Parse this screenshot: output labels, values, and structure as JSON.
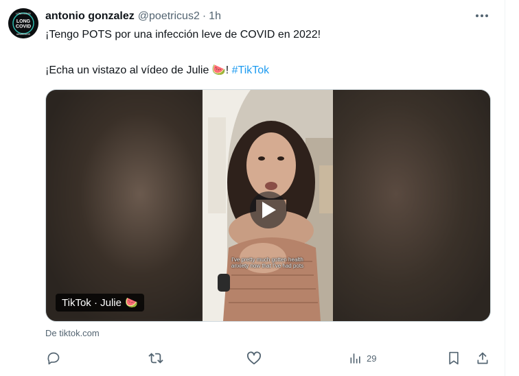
{
  "tweet": {
    "author_name": "antonio gonzalez",
    "handle": "@poetricus2",
    "separator": "·",
    "time": "1h",
    "text_line1": "¡Tengo POTS por una infección leve de COVID en 2022!",
    "text_line2": "¡Echa un vistazo al vídeo de Julie",
    "watermelon": "🍉",
    "text_line2_end": "!",
    "hashtag": "#TikTok"
  },
  "avatar": {
    "top_text": "LONG COVID",
    "main_text_1": "LONG",
    "main_text_2": "COVID",
    "bottom_text": "AWARENESS"
  },
  "media": {
    "caption_text": "I've pretty much gotten health anxiety now that I've had pots",
    "source_label": "TikTok · Julie",
    "source_emoji": "🍉"
  },
  "card_domain": "De tiktok.com",
  "actions": {
    "views_count": "29"
  },
  "icons": {
    "more": "more-icon",
    "reply": "reply-icon",
    "retweet": "retweet-icon",
    "like": "like-icon",
    "views": "views-icon",
    "bookmark": "bookmark-icon",
    "share": "share-icon",
    "play": "play-icon"
  },
  "colors": {
    "text_primary": "#0f1419",
    "text_secondary": "#536471",
    "link": "#1d9bf0",
    "border": "#cfd9de"
  }
}
